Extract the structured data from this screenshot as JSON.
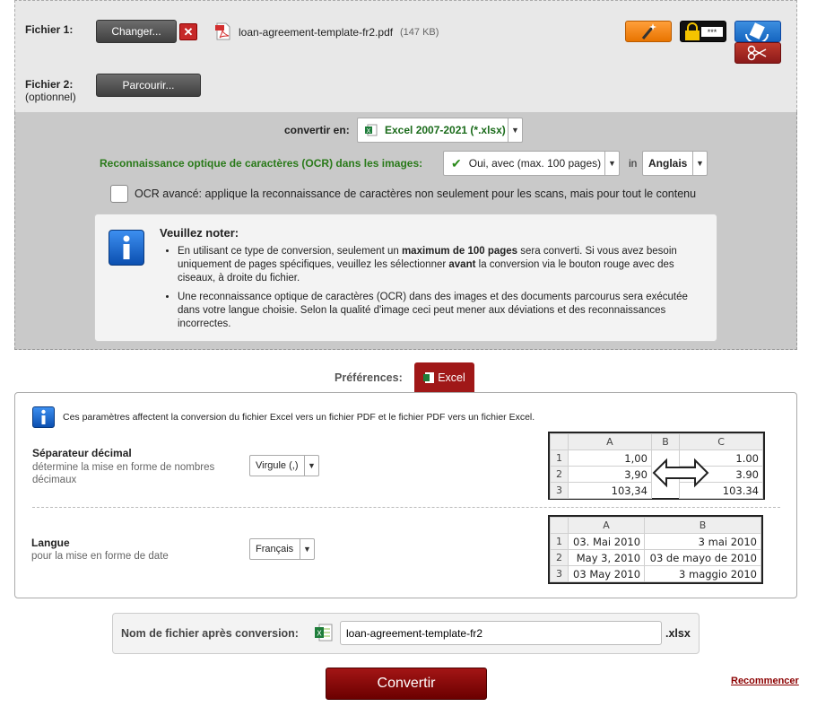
{
  "files": {
    "file1_label": "Fichier 1:",
    "change_btn": "Changer...",
    "file_name": "loan-agreement-template-fr2.pdf",
    "file_size": "(147 KB)",
    "file2_label": "Fichier 2:",
    "file2_sub": "(optionnel)",
    "browse_btn": "Parcourir..."
  },
  "convert": {
    "label": "convertir en:",
    "value": "Excel 2007-2021 (*.xlsx)",
    "ocr_label": "Reconnaissance optique de caractères (OCR) dans les images:",
    "ocr_value": "Oui, avec (max. 100 pages)",
    "in_label": "in",
    "lang_value": "Anglais",
    "ocr_adv": "OCR avancé: applique la reconnaissance de caractères non seulement pour les scans, mais pour tout le contenu"
  },
  "note": {
    "title": "Veuillez noter:",
    "b1_a": "En utilisant ce type de conversion, seulement un ",
    "b1_b": "maximum de 100 pages",
    "b1_c": " sera converti. Si vous avez besoin uniquement de pages spécifiques, veuillez les sélectionner ",
    "b1_d": "avant",
    "b1_e": " la conversion via le bouton rouge avec des ciseaux, à droite du fichier.",
    "b2": "Une reconnaissance optique de caractères (OCR) dans des images et des documents parcourus sera exécutée dans votre langue choisie. Selon la qualité d'image ceci peut mener aux déviations et des reconnaissances incorrectes."
  },
  "prefs": {
    "label": "Préférences:",
    "tab": "Excel",
    "info": "Ces paramètres affectent la conversion du fichier Excel vers un fichier PDF et le fichier PDF vers un fichier Excel.",
    "dec_title": "Séparateur décimal",
    "dec_desc": "détermine la mise en forme de nombres décimaux",
    "dec_value": "Virgule (,)",
    "lang_title": "Langue",
    "lang_desc": "pour la mise en forme de date",
    "lang_value": "Français"
  },
  "table1": {
    "cols": [
      "A",
      "B",
      "C"
    ],
    "rows": [
      [
        "1",
        "1,00",
        "1.00"
      ],
      [
        "2",
        "3,90",
        "3.90"
      ],
      [
        "3",
        "103,34",
        "103.34"
      ]
    ]
  },
  "table2": {
    "cols": [
      "A",
      "B"
    ],
    "rows": [
      [
        "1",
        "03. Mai 2010",
        "3 mai 2010"
      ],
      [
        "2",
        "May 3, 2010",
        "03 de mayo de 2010"
      ],
      [
        "3",
        "03 May 2010",
        "3 maggio 2010"
      ]
    ]
  },
  "output": {
    "label": "Nom de fichier après conversion:",
    "filename": "loan-agreement-template-fr2",
    "ext": ".xlsx",
    "convert_btn": "Convertir",
    "reset": "Recommencer"
  }
}
